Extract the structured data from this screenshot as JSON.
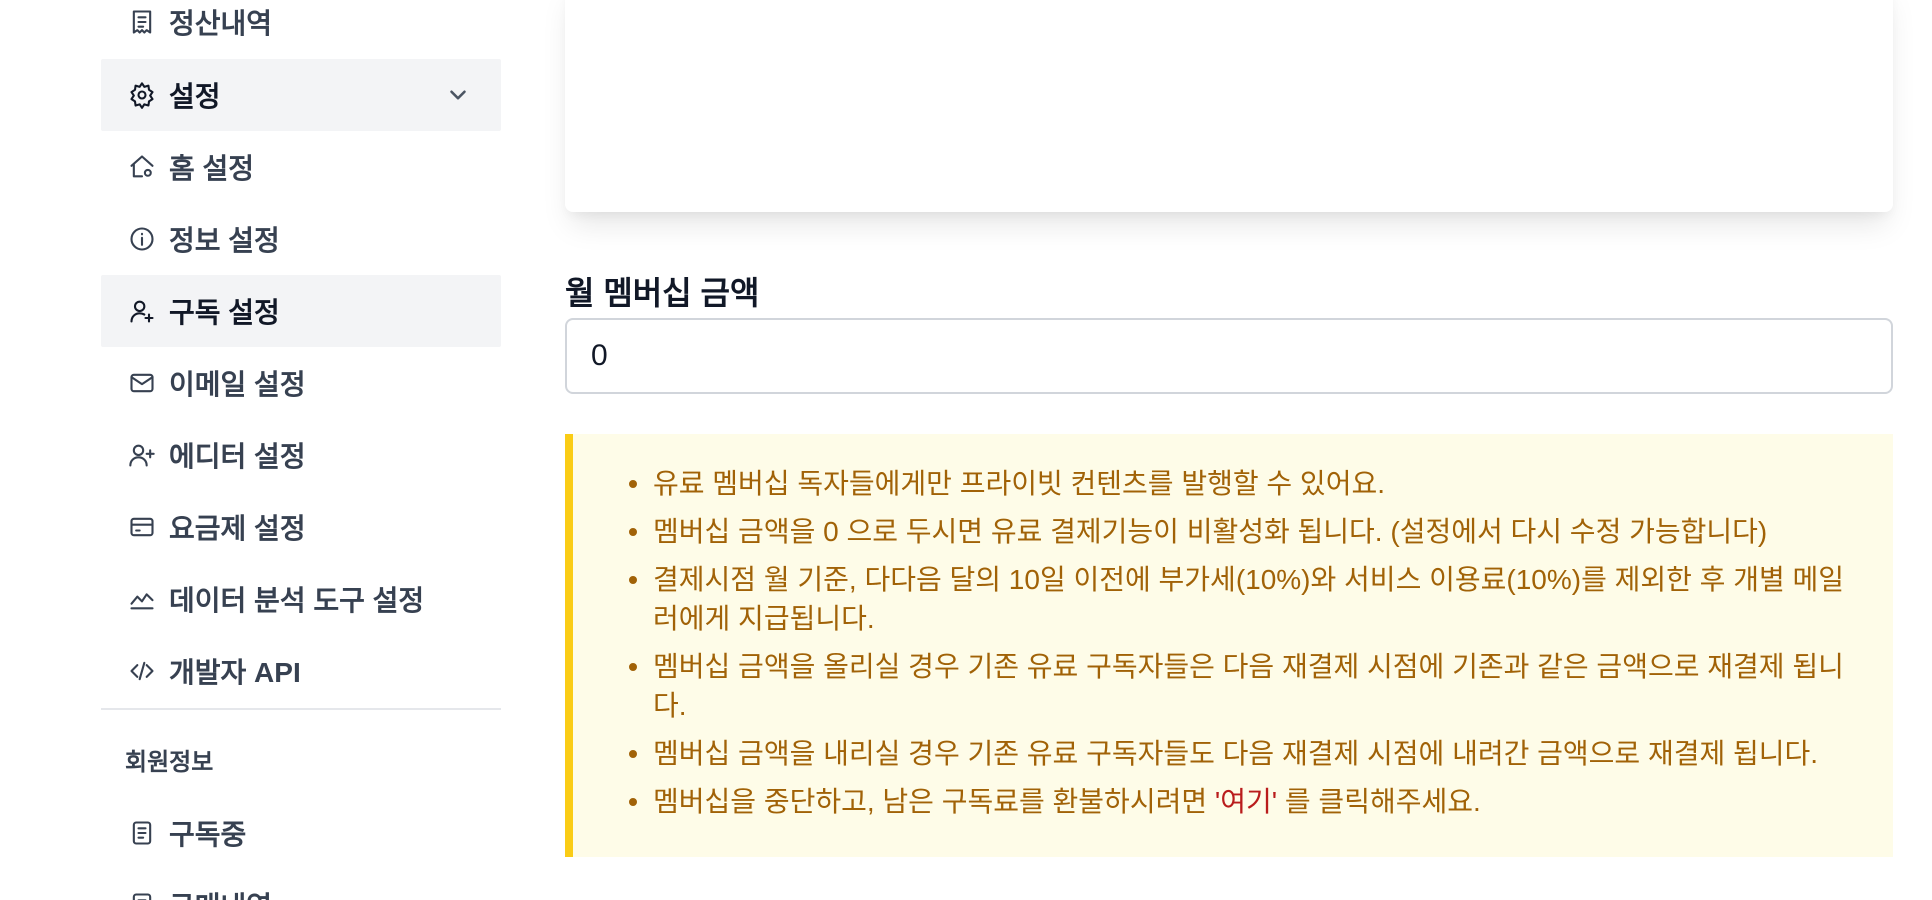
{
  "sidebar": {
    "items": [
      {
        "label": "정산내역",
        "icon": "receipt-icon"
      },
      {
        "label": "설정",
        "icon": "gear-icon"
      },
      {
        "label": "홈 설정",
        "icon": "home-gear-icon"
      },
      {
        "label": "정보 설정",
        "icon": "info-icon"
      },
      {
        "label": "구독 설정",
        "icon": "user-plus-icon"
      },
      {
        "label": "이메일 설정",
        "icon": "mail-icon"
      },
      {
        "label": "에디터 설정",
        "icon": "users-plus-icon"
      },
      {
        "label": "요금제 설정",
        "icon": "credit-card-icon"
      },
      {
        "label": "데이터 분석 도구 설정",
        "icon": "chart-line-icon"
      },
      {
        "label": "개발자 API",
        "icon": "code-icon"
      }
    ],
    "member_section_label": "회원정보",
    "member_items": [
      {
        "label": "구독중",
        "icon": "document-icon"
      },
      {
        "label": "구매내역",
        "icon": "document-icon"
      }
    ]
  },
  "main": {
    "amount_label": "월 멤버십 금액",
    "amount_value": "0",
    "notice": {
      "items": [
        "유료 멤버십 독자들에게만 프라이빗 컨텐츠를 발행할 수 있어요.",
        "멤버십 금액을 0 으로 두시면 유료 결제기능이 비활성화 됩니다. (설정에서 다시 수정 가능합니다)",
        "결제시점 월 기준, 다다음 달의 10일 이전에 부가세(10%)와 서비스 이용료(10%)를 제외한 후 개별 메일러에게 지급됩니다.",
        "멤버십 금액을 올리실 경우 기존 유료 구독자들은 다음 재결제 시점에 기존과 같은 금액으로 재결제 됩니다.",
        "멤버십 금액을 내리실 경우 기존 유료 구독자들도 다음 재결제 시점에 내려간 금액으로 재결제 됩니다."
      ],
      "last_prefix": "멤버십을 중단하고, 남은 구독료를 환불하시려면 ",
      "last_link": "'여기'",
      "last_suffix": " 를 클릭해주세요."
    }
  }
}
